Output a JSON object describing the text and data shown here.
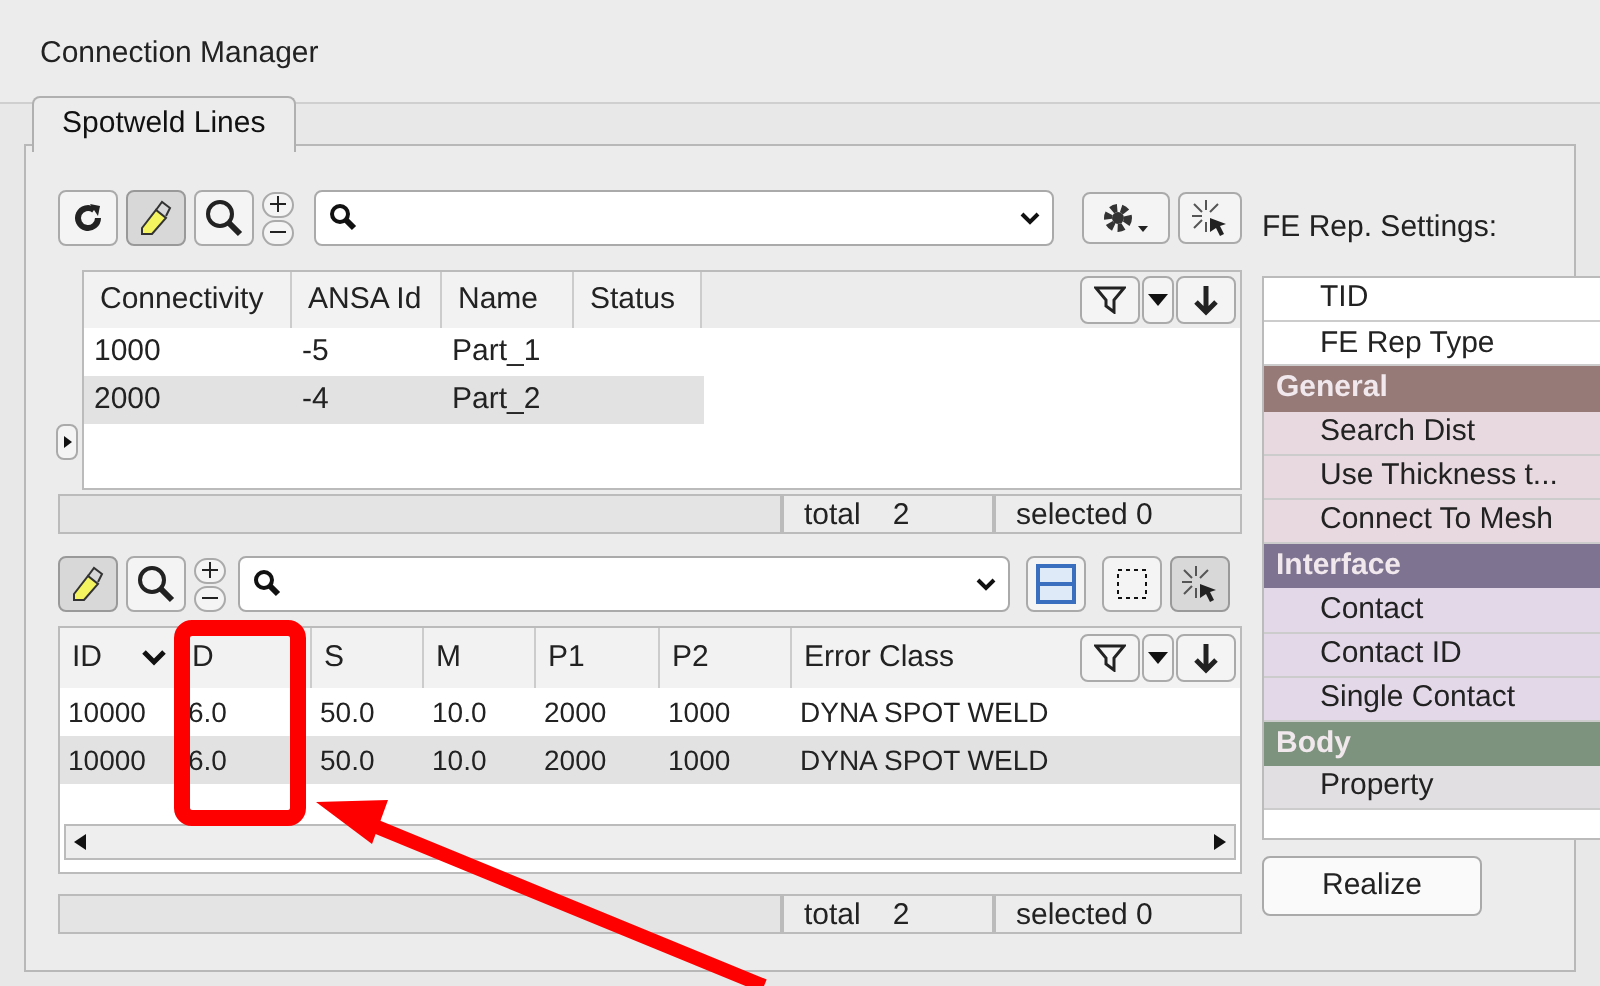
{
  "window": {
    "title": "Connection Manager"
  },
  "tabs": [
    {
      "label": "Spotweld Lines",
      "selected": true
    }
  ],
  "connectivity_table": {
    "columns": [
      "Connectivity",
      "ANSA Id",
      "Name",
      "Status"
    ],
    "rows": [
      [
        "1000",
        "-5",
        "Part_1",
        ""
      ],
      [
        "2000",
        "-4",
        "Part_2",
        ""
      ]
    ],
    "total_label": "total",
    "total": "2",
    "selected": "selected 0"
  },
  "spotweld_table": {
    "columns": [
      "ID",
      "D",
      "S",
      "M",
      "P1",
      "P2",
      "Error Class"
    ],
    "rows": [
      [
        "10000",
        "6.0",
        "50.0",
        "10.0",
        "2000",
        "1000",
        "DYNA SPOT WELD"
      ],
      [
        "10000",
        "6.0",
        "50.0",
        "10.0",
        "2000",
        "1000",
        "DYNA SPOT WELD"
      ]
    ],
    "total_label": "total",
    "total": "2",
    "selected": "selected 0"
  },
  "fe_rep_settings": {
    "title": "FE Rep. Settings:",
    "items": [
      "TID",
      "FE Rep Type"
    ],
    "groups": [
      {
        "label": "General",
        "color": "#957a78",
        "children": [
          "Search Dist",
          "Use Thickness t...",
          "Connect To Mesh"
        ]
      },
      {
        "label": "Interface",
        "color": "#7e7391",
        "children": [
          "Contact",
          "Contact ID",
          "Single Contact"
        ]
      },
      {
        "label": "Body",
        "color": "#7d937d",
        "children": [
          "Property"
        ]
      }
    ],
    "button": "Realize"
  }
}
